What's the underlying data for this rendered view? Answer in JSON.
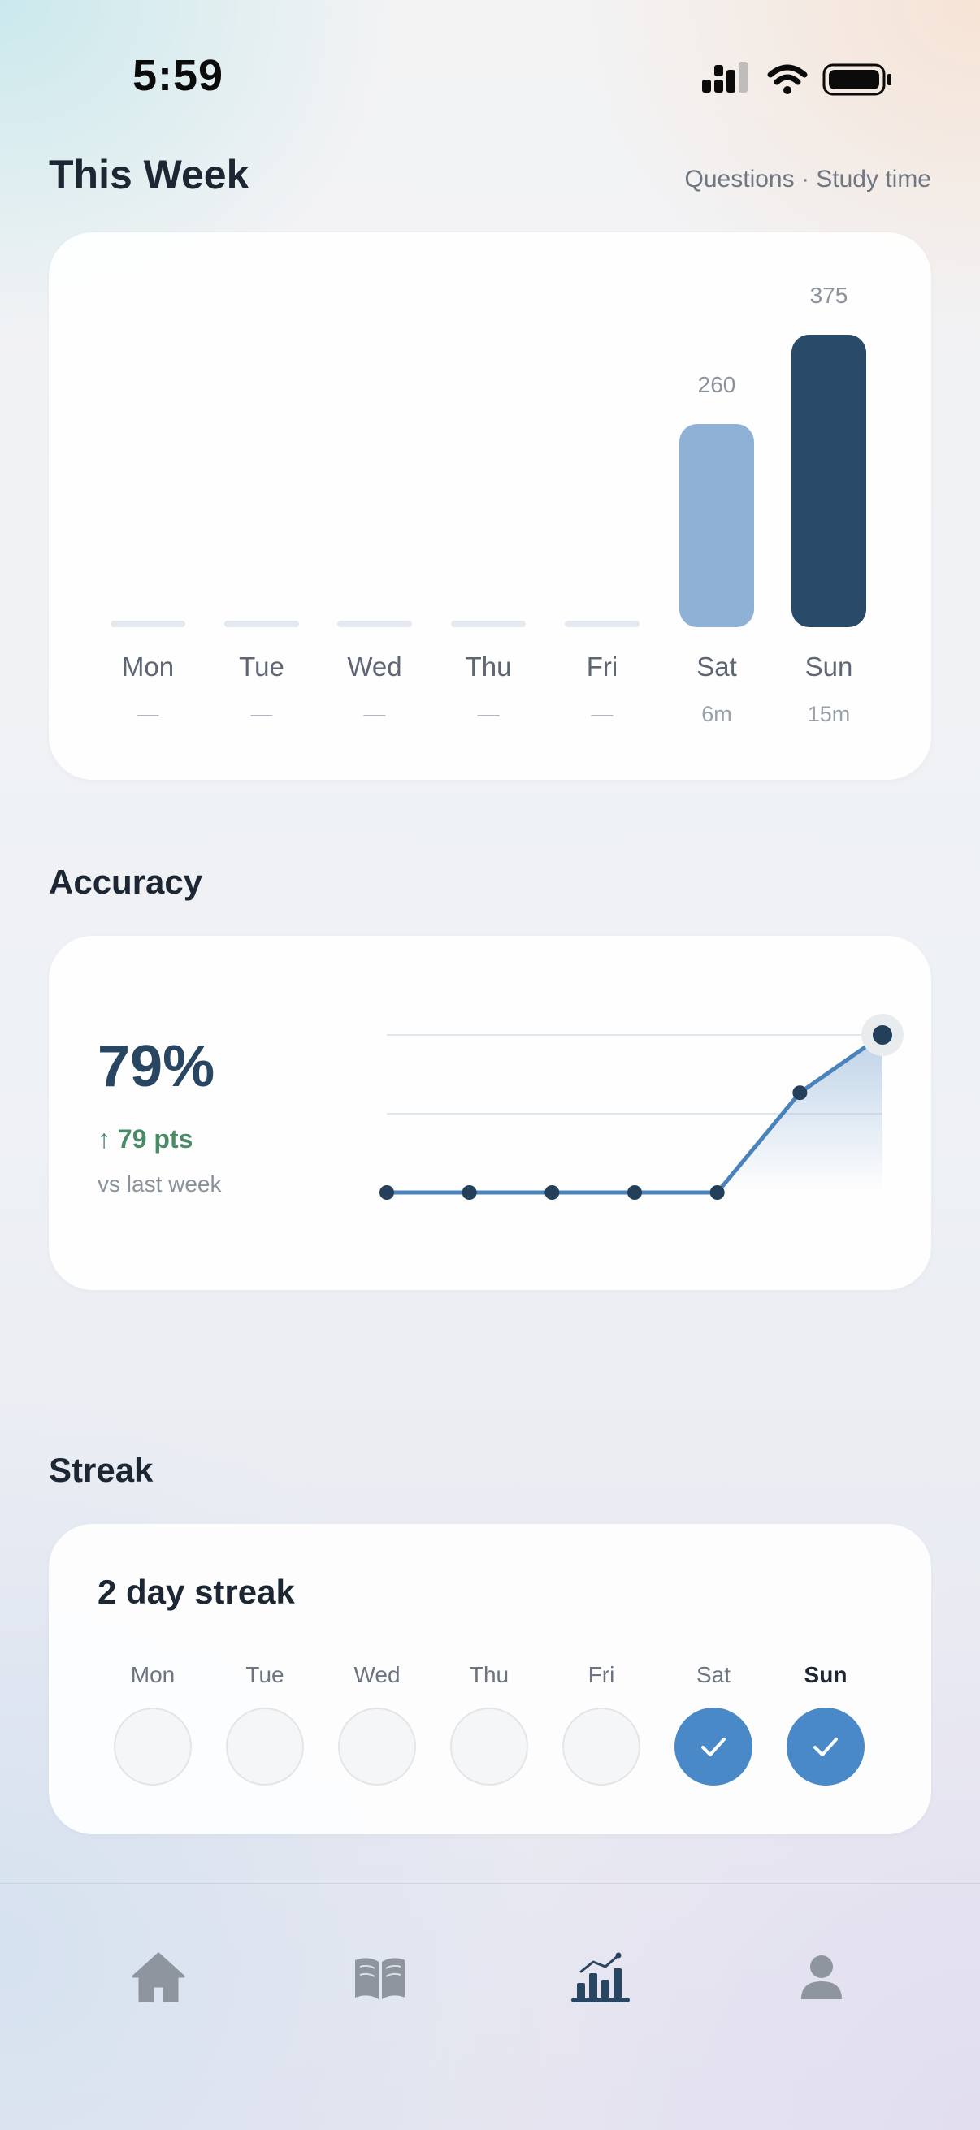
{
  "status_bar": {
    "time": "5:59"
  },
  "this_week": {
    "title": "This Week",
    "legend": "Questions · Study time"
  },
  "chart_data": [
    {
      "type": "bar",
      "categories": [
        "Mon",
        "Tue",
        "Wed",
        "Thu",
        "Fri",
        "Sat",
        "Sun"
      ],
      "series": [
        {
          "values": [
            0,
            0,
            0,
            0,
            0,
            260,
            375
          ]
        }
      ],
      "value_labels": [
        "",
        "",
        "",
        "",
        "",
        "260",
        "375"
      ],
      "study_time": [
        "—",
        "—",
        "—",
        "—",
        "—",
        "6m",
        "15m"
      ],
      "ylim": [
        0,
        375
      ],
      "colors": [
        "#e4e9ef",
        "#e4e9ef",
        "#e4e9ef",
        "#e4e9ef",
        "#e4e9ef",
        "#8fb1d6",
        "#294a68"
      ]
    },
    {
      "type": "line",
      "x": [
        "Mon",
        "Tue",
        "Wed",
        "Thu",
        "Fri",
        "Sat",
        "Sun"
      ],
      "series": [
        {
          "values": [
            0,
            0,
            0,
            0,
            0,
            50,
            79
          ]
        }
      ],
      "ylim": [
        0,
        79
      ],
      "grid": true,
      "color": "#4a82bb"
    }
  ],
  "accuracy": {
    "title": "Accuracy",
    "value": "79%",
    "delta": "↑ 79 pts",
    "sub": "vs last week"
  },
  "streak": {
    "title": "Streak",
    "text": "2 day streak",
    "days": [
      {
        "label": "Mon",
        "done": false,
        "today": false
      },
      {
        "label": "Tue",
        "done": false,
        "today": false
      },
      {
        "label": "Wed",
        "done": false,
        "today": false
      },
      {
        "label": "Thu",
        "done": false,
        "today": false
      },
      {
        "label": "Fri",
        "done": false,
        "today": false
      },
      {
        "label": "Sat",
        "done": true,
        "today": false
      },
      {
        "label": "Sun",
        "done": true,
        "today": true
      }
    ],
    "done_color": "#4a89c8"
  },
  "tabbar": {
    "tabs": [
      {
        "icon": "home-icon",
        "active": false
      },
      {
        "icon": "book-icon",
        "active": false
      },
      {
        "icon": "stats-icon",
        "active": true
      },
      {
        "icon": "profile-icon",
        "active": false
      }
    ],
    "active_color": "#284661",
    "inactive_color": "#8e959f"
  }
}
